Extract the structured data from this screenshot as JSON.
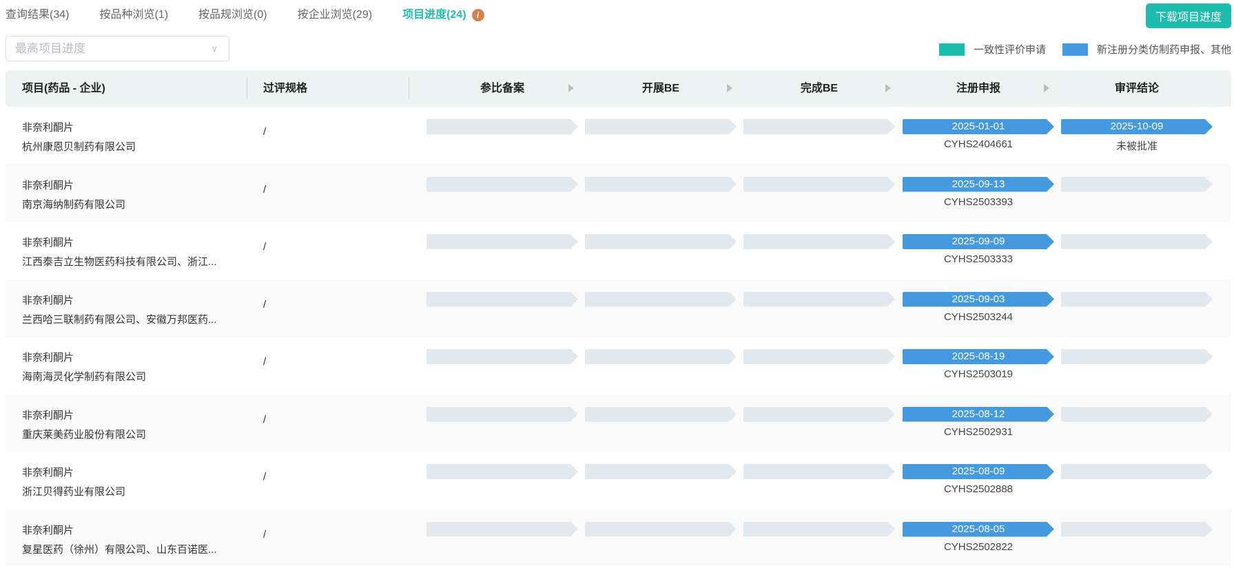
{
  "tabs": [
    {
      "label": "查询结果(34)"
    },
    {
      "label": "按品种浏览(1)"
    },
    {
      "label": "按品规浏览(0)"
    },
    {
      "label": "按企业浏览(29)"
    },
    {
      "label": "项目进度(24)"
    }
  ],
  "download_label": "下载项目进度",
  "filter": {
    "placeholder": "最高项目进度"
  },
  "legend": [
    {
      "label": "一致性评价申请",
      "color": "#1fbdaf"
    },
    {
      "label": "新注册分类仿制药申报、其他",
      "color": "#4599df"
    }
  ],
  "columns": [
    "项目(药品 - 企业)",
    "过评规格",
    "参比备案",
    "开展BE",
    "完成BE",
    "注册申报",
    "审评结论"
  ],
  "rows": [
    {
      "drug": "非奈利酮片",
      "company": "杭州康恩贝制药有限公司",
      "spec": "/",
      "reg_date": "2025-01-01",
      "reg_code": "CYHS2404661",
      "review_date": "2025-10-09",
      "review_result": "未被批准"
    },
    {
      "drug": "非奈利酮片",
      "company": "南京海纳制药有限公司",
      "spec": "/",
      "reg_date": "2025-09-13",
      "reg_code": "CYHS2503393"
    },
    {
      "drug": "非奈利酮片",
      "company": "江西泰吉立生物医药科技有限公司、浙江...",
      "spec": "/",
      "reg_date": "2025-09-09",
      "reg_code": "CYHS2503333"
    },
    {
      "drug": "非奈利酮片",
      "company": "兰西哈三联制药有限公司、安徽万邦医药...",
      "spec": "/",
      "reg_date": "2025-09-03",
      "reg_code": "CYHS2503244"
    },
    {
      "drug": "非奈利酮片",
      "company": "海南海灵化学制药有限公司",
      "spec": "/",
      "reg_date": "2025-08-19",
      "reg_code": "CYHS2503019"
    },
    {
      "drug": "非奈利酮片",
      "company": "重庆莱美药业股份有限公司",
      "spec": "/",
      "reg_date": "2025-08-12",
      "reg_code": "CYHS2502931"
    },
    {
      "drug": "非奈利酮片",
      "company": "浙江贝得药业有限公司",
      "spec": "/",
      "reg_date": "2025-08-09",
      "reg_code": "CYHS2502888"
    },
    {
      "drug": "非奈利酮片",
      "company": "复星医药（徐州）有限公司、山东百诺医...",
      "spec": "/",
      "reg_date": "2025-08-05",
      "reg_code": "CYHS2502822"
    }
  ]
}
